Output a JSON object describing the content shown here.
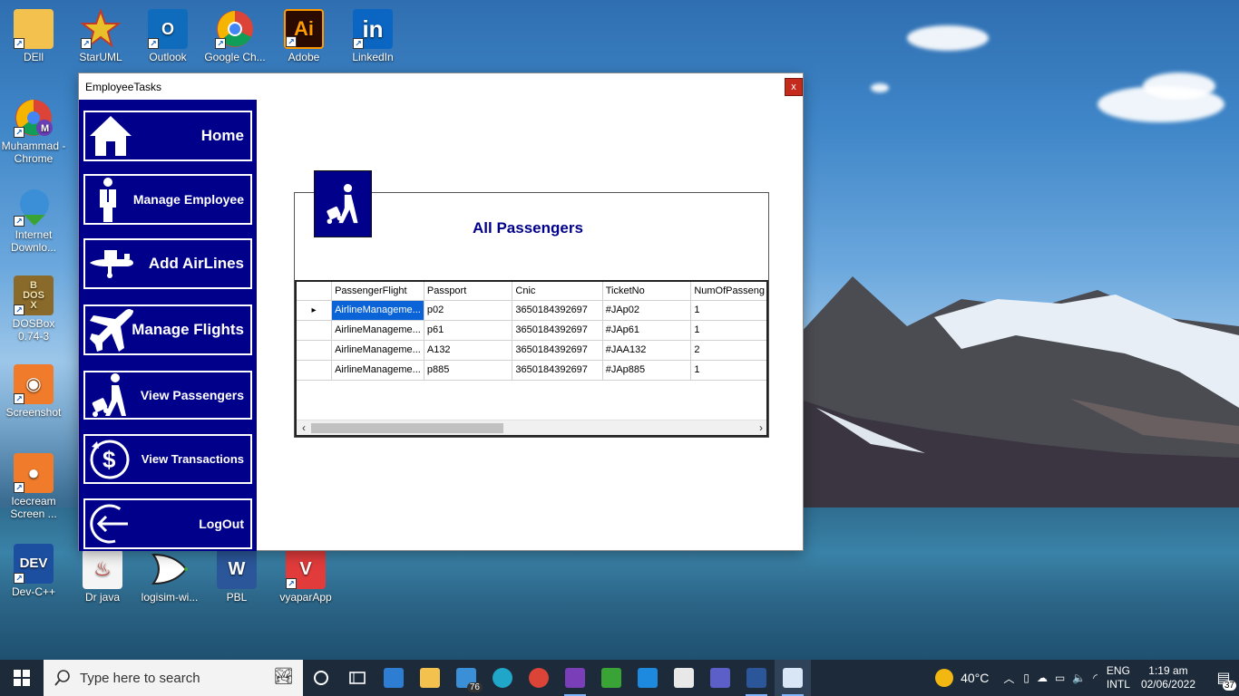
{
  "desktop": {
    "icons": [
      {
        "label": "DEll",
        "color": "#f2c14e"
      },
      {
        "label": "StarUML",
        "color": "#d83b3b"
      },
      {
        "label": "Outlook",
        "color": "#0f6cbd"
      },
      {
        "label": "Google Ch...",
        "color": "#e9e9e9"
      },
      {
        "label": "Adobe Illustrat...",
        "color": "#2b0b00"
      },
      {
        "label": "LinkedIn",
        "color": "#0a66c2"
      },
      {
        "label": "Muhammad - Chrome",
        "color": "#e9e9e9"
      },
      {
        "label": "Internet Downlo...",
        "color": "#3aa335"
      },
      {
        "label": "DOSBox 0.74-3",
        "color": "#8a6a2a"
      },
      {
        "label": "Screenshot",
        "color": "#f07b2a"
      },
      {
        "label": "Icecream Screen ...",
        "color": "#f07b2a"
      },
      {
        "label": "Dev-C++",
        "color": "#1d4fa0"
      },
      {
        "label": "Dr java",
        "color": "#f5f5f5"
      },
      {
        "label": "logisim-wi...",
        "color": "#f5f5f5"
      },
      {
        "label": "PBL",
        "color": "#2b579a"
      },
      {
        "label": "vyaparApp",
        "color": "#e23b3b"
      }
    ]
  },
  "window": {
    "title": "EmployeeTasks",
    "close_label": "x"
  },
  "sidebar": {
    "bg": "#00008b",
    "items": [
      {
        "label": "Home",
        "icon": "home-icon"
      },
      {
        "label": "Manage Employee",
        "icon": "employee-icon"
      },
      {
        "label": "Add AirLines",
        "icon": "airplane-icon"
      },
      {
        "label": "Manage Flights",
        "icon": "flight-icon"
      },
      {
        "label": "View Passengers",
        "icon": "passenger-icon"
      },
      {
        "label": "View Transactions",
        "icon": "transaction-icon"
      },
      {
        "label": "LogOut",
        "icon": "logout-icon"
      }
    ]
  },
  "content": {
    "title": "All Passengers",
    "grid": {
      "columns": [
        "PassengerFlight",
        "Passport",
        "Cnic",
        "TicketNo",
        "NumOfPasseng"
      ],
      "rows": [
        [
          "AirlineManageme...",
          "p02",
          "3650184392697",
          "#JAp02",
          "1"
        ],
        [
          "AirlineManageme...",
          "p61",
          "3650184392697",
          "#JAp61",
          "1"
        ],
        [
          "AirlineManageme...",
          "A132",
          "3650184392697",
          "#JAA132",
          "2"
        ],
        [
          "AirlineManageme...",
          "p885",
          "3650184392697",
          "#JAp885",
          "1"
        ]
      ],
      "selected_row": 0,
      "current_row_marker": "▸"
    }
  },
  "taskbar": {
    "search_placeholder": "Type here to search",
    "badge_count": "76",
    "weather": "40°C",
    "language_1": "ENG",
    "language_2": "INTL",
    "time": "1:19 am",
    "date": "02/06/2022",
    "notifications": "37"
  }
}
